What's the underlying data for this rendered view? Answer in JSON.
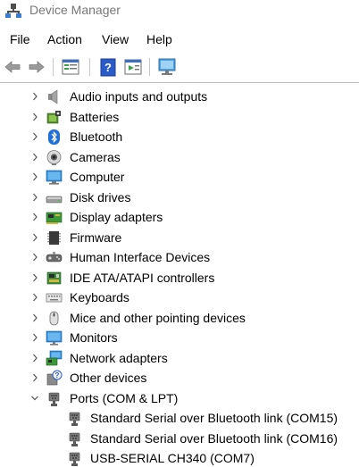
{
  "window": {
    "title": "Device Manager"
  },
  "menu": {
    "file": "File",
    "action": "Action",
    "view": "View",
    "help": "Help"
  },
  "toolbar": {
    "buttons": [
      "back-icon",
      "forward-icon",
      "properties-icon",
      "help-icon",
      "run-icon",
      "scan-hardware-icon"
    ]
  },
  "tree": {
    "categories": [
      {
        "label": "Audio inputs and outputs",
        "icon": "speaker-icon",
        "expanded": false
      },
      {
        "label": "Batteries",
        "icon": "battery-icon",
        "expanded": false
      },
      {
        "label": "Bluetooth",
        "icon": "bluetooth-icon",
        "expanded": false
      },
      {
        "label": "Cameras",
        "icon": "camera-icon",
        "expanded": false
      },
      {
        "label": "Computer",
        "icon": "computer-icon",
        "expanded": false
      },
      {
        "label": "Disk drives",
        "icon": "disk-drive-icon",
        "expanded": false
      },
      {
        "label": "Display adapters",
        "icon": "display-adapter-icon",
        "expanded": false
      },
      {
        "label": "Firmware",
        "icon": "firmware-icon",
        "expanded": false
      },
      {
        "label": "Human Interface Devices",
        "icon": "hid-icon",
        "expanded": false
      },
      {
        "label": "IDE ATA/ATAPI controllers",
        "icon": "ide-controller-icon",
        "expanded": false
      },
      {
        "label": "Keyboards",
        "icon": "keyboard-icon",
        "expanded": false
      },
      {
        "label": "Mice and other pointing devices",
        "icon": "mouse-icon",
        "expanded": false
      },
      {
        "label": "Monitors",
        "icon": "monitor-icon",
        "expanded": false
      },
      {
        "label": "Network adapters",
        "icon": "network-adapter-icon",
        "expanded": false
      },
      {
        "label": "Other devices",
        "icon": "unknown-device-icon",
        "expanded": false
      },
      {
        "label": "Ports (COM & LPT)",
        "icon": "port-icon",
        "expanded": true
      }
    ],
    "port_children": [
      {
        "label": "Standard Serial over Bluetooth link (COM15)",
        "icon": "port-icon"
      },
      {
        "label": "Standard Serial over Bluetooth link (COM16)",
        "icon": "port-icon"
      },
      {
        "label": "USB-SERIAL CH340 (COM7)",
        "icon": "port-icon"
      }
    ]
  }
}
